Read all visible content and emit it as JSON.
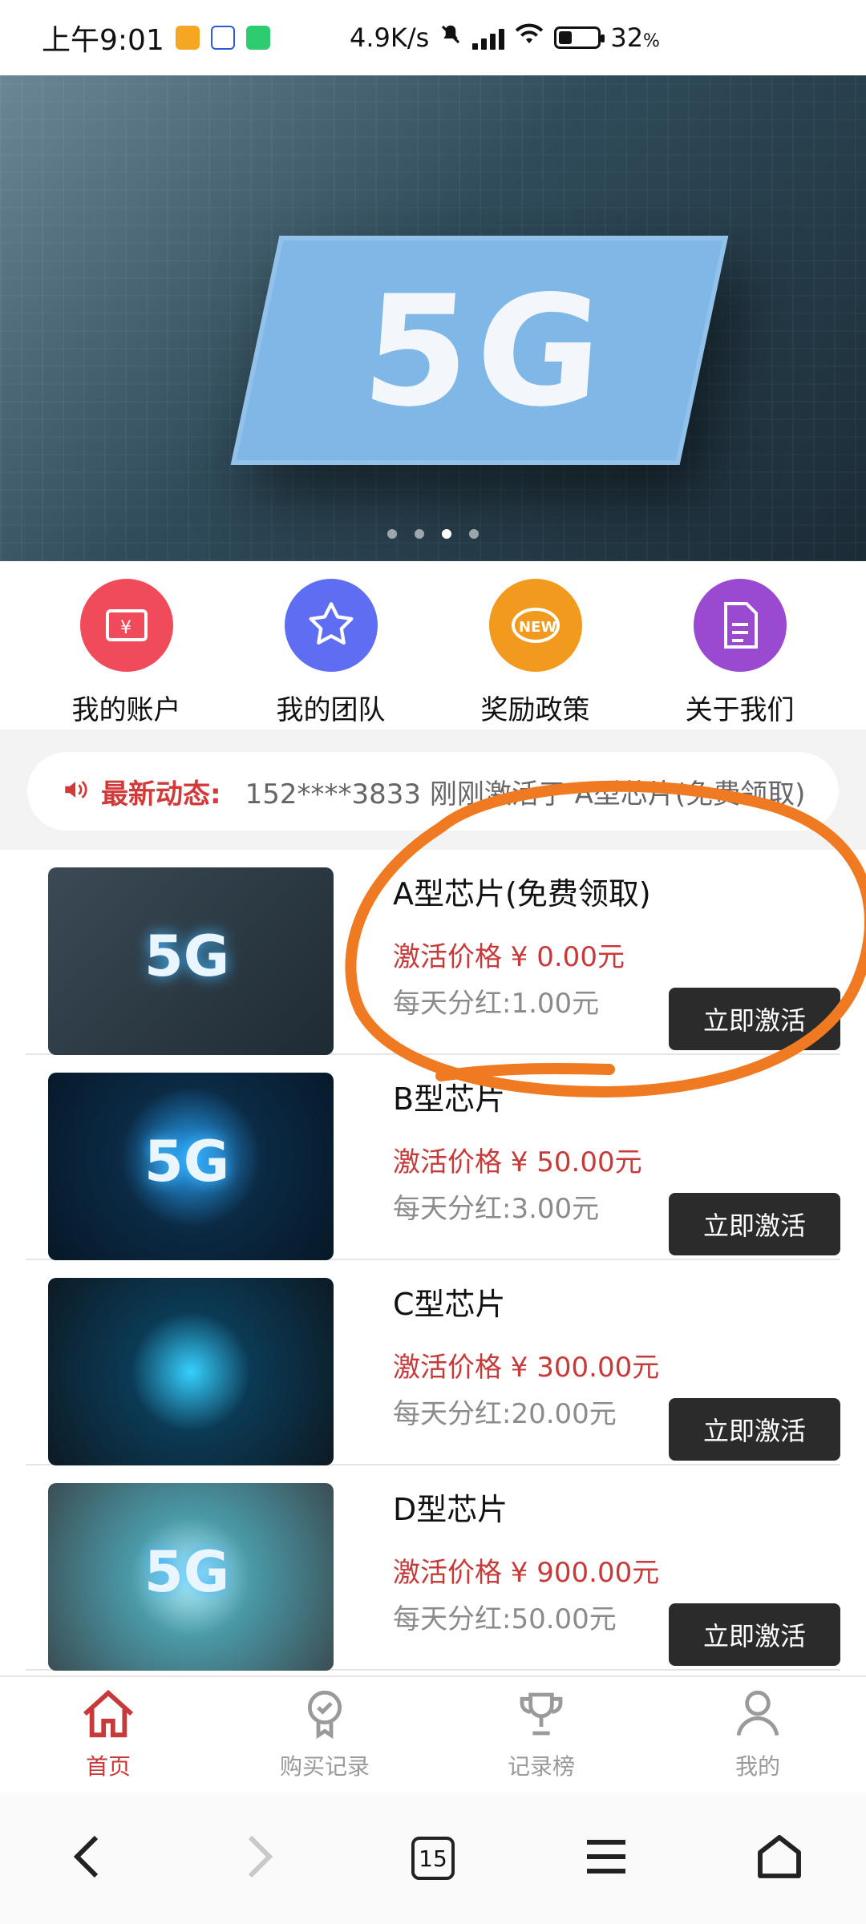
{
  "status_bar": {
    "time": "上午9:01",
    "network_speed": "4.9K/s",
    "battery_percent": "32",
    "battery_suffix": "%"
  },
  "banner": {
    "caption": "5G",
    "slides": 4,
    "active_slide": 3
  },
  "quick_menu": [
    {
      "label": "我的账户",
      "icon": "wallet-icon",
      "color": "#ef4b5a"
    },
    {
      "label": "我的团队",
      "icon": "star-icon",
      "color": "#5f6df2"
    },
    {
      "label": "奖励政策",
      "icon": "new-badge-icon",
      "color": "#f29a1d"
    },
    {
      "label": "关于我们",
      "icon": "document-icon",
      "color": "#9a4ad0"
    }
  ],
  "news": {
    "label": "最新动态:",
    "text": "152****3833 刚刚激活了 A型芯片(免费领取)"
  },
  "products": [
    {
      "title": "A型芯片(免费领取)",
      "price": "激活价格 ¥ 0.00元",
      "bonus": "每天分红:1.00元",
      "button": "立即激活",
      "thumb": "5G"
    },
    {
      "title": "B型芯片",
      "price": "激活价格 ¥ 50.00元",
      "bonus": "每天分红:3.00元",
      "button": "立即激活",
      "thumb": "5G"
    },
    {
      "title": "C型芯片",
      "price": "激活价格 ¥ 300.00元",
      "bonus": "每天分红:20.00元",
      "button": "立即激活",
      "thumb": ""
    },
    {
      "title": "D型芯片",
      "price": "激活价格 ¥ 900.00元",
      "bonus": "每天分红:50.00元",
      "button": "立即激活",
      "thumb": "5G"
    }
  ],
  "tabbar": [
    {
      "label": "首页",
      "icon": "home-icon",
      "active": true
    },
    {
      "label": "购买记录",
      "icon": "badge-check-icon",
      "active": false
    },
    {
      "label": "记录榜",
      "icon": "trophy-icon",
      "active": false
    },
    {
      "label": "我的",
      "icon": "user-icon",
      "active": false
    }
  ],
  "browser_bar": {
    "tab_count": "15"
  },
  "colors": {
    "accent_red": "#c83a3a",
    "button_dark": "#2b2b2b",
    "annotation_orange": "#f07a22"
  }
}
